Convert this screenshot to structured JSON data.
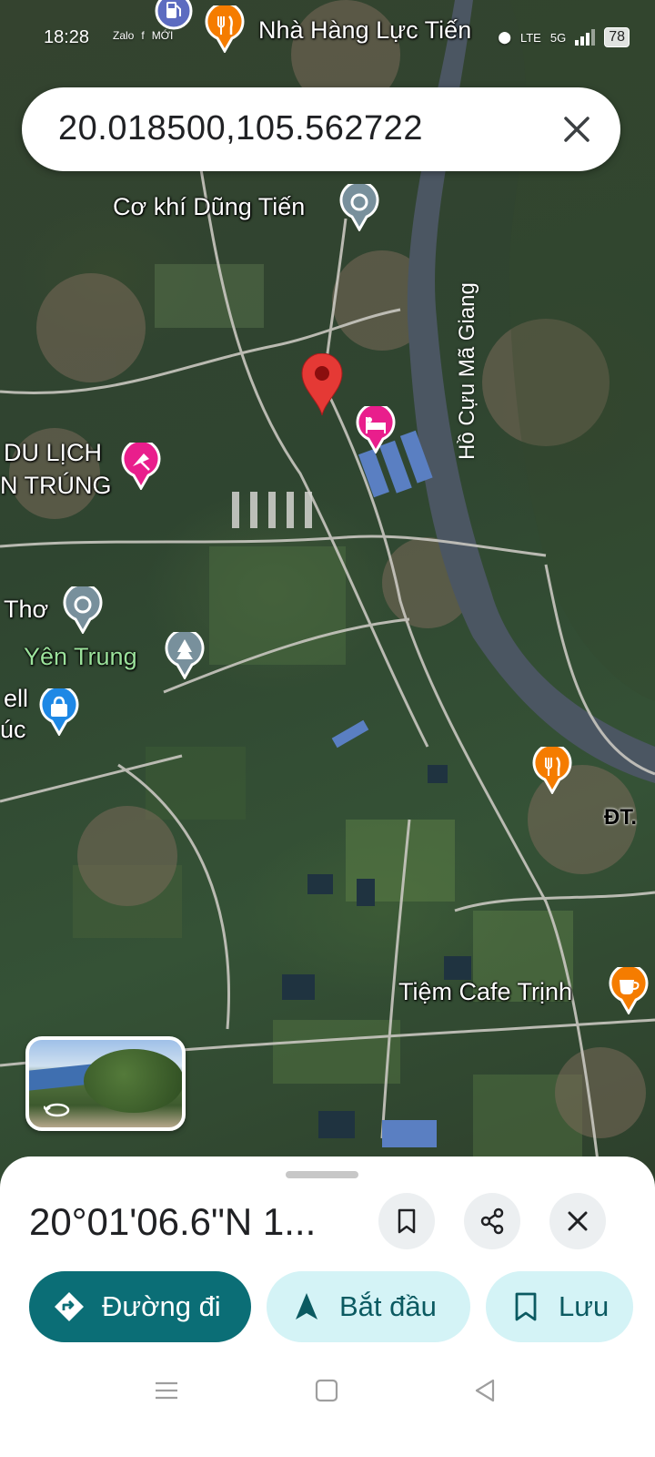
{
  "status_bar": {
    "time": "18:28",
    "app_icons": [
      "Zalo",
      "f",
      "MỚI"
    ],
    "network": "LTE",
    "signal": "5G",
    "battery": "78"
  },
  "search": {
    "query": "20.018500,105.562722"
  },
  "map": {
    "labels": {
      "restaurant_top": "Nhà Hàng Lực Tiến",
      "co_khi": "Cơ khí Dũng Tiến",
      "river": "Hồ Cựu Mã Giang",
      "du_lich_1": "DU LỊCH",
      "du_lich_2": "N TRÚNG",
      "tho": "Thơ",
      "yen_trung": "Yên Trung",
      "ell": "ell",
      "uc": "úc",
      "road": "ĐT.",
      "cafe": "Tiệm Cafe Trịnh"
    },
    "icons": [
      "fuel-icon",
      "restaurant-icon",
      "pin-icon",
      "hotel-icon",
      "tourist-icon",
      "park-icon",
      "shopping-icon",
      "cafe-icon"
    ],
    "pin_color": "#e53935"
  },
  "sheet": {
    "title": "20°01'06.6\"N 1...",
    "directions_label": "Đường đi",
    "start_label": "Bắt đầu",
    "save_label": "Lưu"
  },
  "colors": {
    "primary": "#0b6e76",
    "secondary_bg": "#d4f3f6",
    "restaurant": "#f57c00",
    "hotel": "#e91e8c",
    "place": "#78909c",
    "shopping": "#1e88e5"
  }
}
